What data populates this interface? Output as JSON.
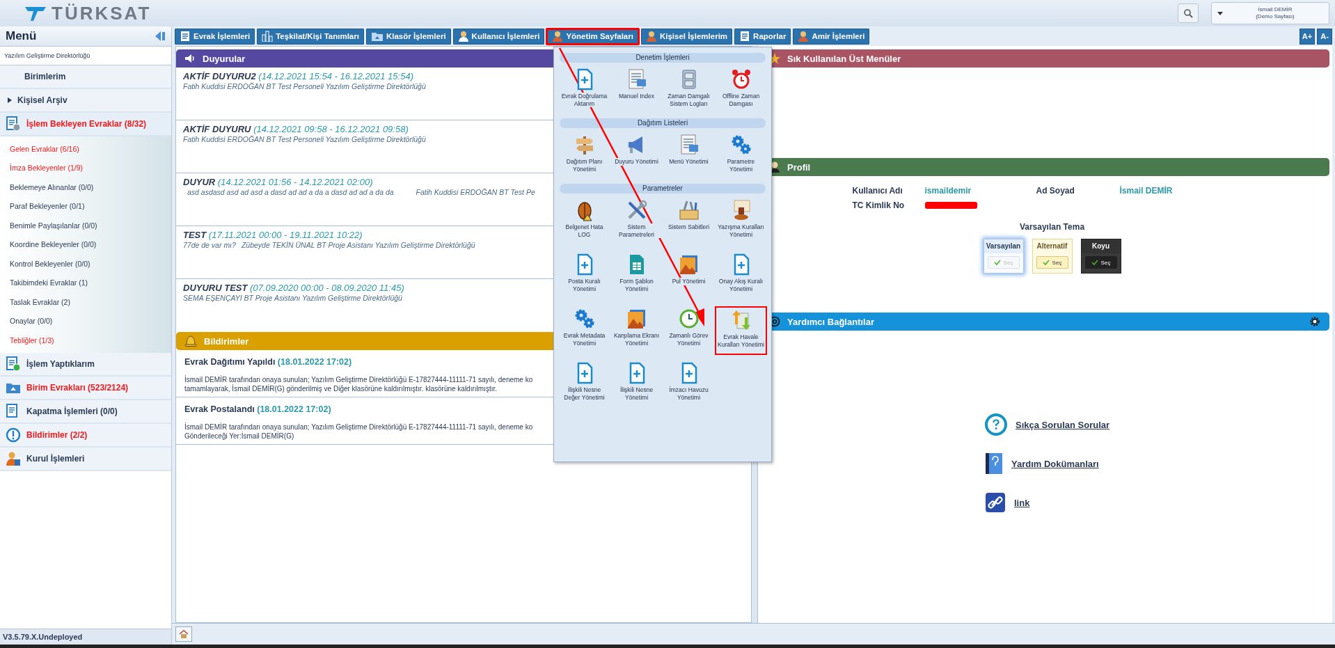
{
  "header": {
    "logo": "TÜRKSAT",
    "user": {
      "name": "İsmail DEMİR",
      "subtitle": "(Demo Sayfası)"
    }
  },
  "sidebar": {
    "title": "Menü",
    "unit": "Yazılım Geliştirme Direktörlüğü",
    "version": "V3.5.79.X.Undeployed",
    "items": [
      {
        "label": "Birimlerim",
        "alert": false
      },
      {
        "label": "Kişisel Arşiv",
        "alert": false
      },
      {
        "label": "İşlem Bekleyen Evraklar (8/32)",
        "alert": true,
        "expanded": true,
        "children": [
          {
            "label": "Gelen Evraklar (6/16)",
            "alert": true
          },
          {
            "label": "İmza Bekleyenler (1/9)",
            "alert": true
          },
          {
            "label": "Beklemeye Alınanlar (0/0)",
            "alert": false
          },
          {
            "label": "Paraf Bekleyenler (0/1)",
            "alert": false
          },
          {
            "label": "Benimle Paylaşılanlar (0/0)",
            "alert": false
          },
          {
            "label": "Koordine Bekleyenler (0/0)",
            "alert": false
          },
          {
            "label": "Kontrol Bekleyenler (0/0)",
            "alert": false
          },
          {
            "label": "Takibimdeki Evraklar (1)",
            "alert": false
          },
          {
            "label": "Taslak Evraklar (2)",
            "alert": false
          },
          {
            "label": "Onaylar (0/0)",
            "alert": false
          },
          {
            "label": "Tebliğler (1/3)",
            "alert": true
          }
        ]
      },
      {
        "label": "İşlem Yaptıklarım",
        "alert": false
      },
      {
        "label": "Birim Evrakları (523/2124)",
        "alert": true
      },
      {
        "label": "Kapatma İşlemleri (0/0)",
        "alert": false
      },
      {
        "label": "Bildirimler (2/2)",
        "alert": true
      },
      {
        "label": "Kurul İşlemleri",
        "alert": false
      }
    ]
  },
  "toolbar": {
    "buttons": [
      {
        "label": "Evrak İşlemleri",
        "highlighted": false
      },
      {
        "label": "Teşkilat/Kişi Tanımları",
        "highlighted": false
      },
      {
        "label": "Klasör İşlemleri",
        "highlighted": false
      },
      {
        "label": "Kullanıcı İşlemleri",
        "highlighted": false
      },
      {
        "label": "Yönetim Sayfaları",
        "highlighted": true
      },
      {
        "label": "Kişisel İşlemlerim",
        "highlighted": false
      },
      {
        "label": "Raporlar",
        "highlighted": false
      },
      {
        "label": "Amir İşlemleri",
        "highlighted": false
      }
    ],
    "font_buttons": [
      "A+",
      "A-"
    ]
  },
  "dropdown": {
    "sections": [
      {
        "title": "Denetim İşlemleri",
        "items": [
          {
            "label": "Evrak Doğrulama Aktarım",
            "highlighted": false
          },
          {
            "label": "Manuel Index",
            "highlighted": false
          },
          {
            "label": "Zaman Damgalı Sistem Logları",
            "highlighted": false
          },
          {
            "label": "Offline Zaman Damgası",
            "highlighted": false
          }
        ]
      },
      {
        "title": "Dağıtım Listeleri",
        "items": [
          {
            "label": "Dağıtım Planı Yönetimi",
            "highlighted": false
          },
          {
            "label": "Duyuru Yönetimi",
            "highlighted": false
          },
          {
            "label": "Menü Yönetimi",
            "highlighted": false
          },
          {
            "label": "Parametre Yönetimi",
            "highlighted": false
          }
        ]
      },
      {
        "title": "Parametreler",
        "items": [
          {
            "label": "Belgenet Hata LOG",
            "highlighted": false
          },
          {
            "label": "Sistem Parametreleri",
            "highlighted": false
          },
          {
            "label": "Sistem Sabitleri",
            "highlighted": false
          },
          {
            "label": "Yazışma Kuralları Yönetimi",
            "highlighted": false
          },
          {
            "label": "Posta Kuralı Yönetimi",
            "highlighted": false
          },
          {
            "label": "Form Şablon Yönetimi",
            "highlighted": false
          },
          {
            "label": "Pul Yönetimi",
            "highlighted": false
          },
          {
            "label": "Onay Akış Kuralı Yönetimi",
            "highlighted": false
          },
          {
            "label": "Evrak Metadata Yönetimi",
            "highlighted": false
          },
          {
            "label": "Karşılama Ekranı Yönetimi",
            "highlighted": false
          },
          {
            "label": "Zamanlı Görev Yönetimi",
            "highlighted": false
          },
          {
            "label": "Evrak Havale Kuralları Yönetimi",
            "highlighted": true
          },
          {
            "label": "İlişkili Nesne Değer Yönetimi",
            "highlighted": false
          },
          {
            "label": "İlişkili Nesne Yönetimi",
            "highlighted": false
          },
          {
            "label": "İmzacı Havuzu Yönetimi",
            "highlighted": false
          }
        ]
      }
    ]
  },
  "annotation_arrow": true,
  "announcements": {
    "title": "Duyurular",
    "items": [
      {
        "title": "AKTİF DUYURU2",
        "period": "(14.12.2021 15:54 - 16.12.2021 15:54)",
        "author": "Fatih Kuddisi ERDOĞAN BT Test Personeli Yazılım Geliştirme Direktörlüğü"
      },
      {
        "title": "AKTİF DUYURU",
        "period": "(14.12.2021 09:58 - 16.12.2021 09:58)",
        "author": "Fatih Kuddisi ERDOĞAN BT Test Personeli Yazılım Geliştirme Direktörlüğü"
      },
      {
        "title": "DUYUR",
        "period": "(14.12.2021 01:56 - 14.12.2021 02:00)",
        "message": "asd asdasd asd ad asd a dasd ad ad a da a dasd ad ad a da da",
        "author": "Fatih Kuddisi ERDOĞAN BT Test Pe"
      },
      {
        "title": "TEST",
        "period": "(17.11.2021 00:00 - 19.11.2021 10:22)",
        "message": "77de de var mı?",
        "author": "Zübeyde TEKİN ÜNAL BT Proje Asistanı Yazılım Geliştirme Direktörlüğü"
      },
      {
        "title": "DUYURU TEST",
        "period": "(07.09.2020 00:00 - 08.09.2020 11:45)",
        "author": "SEMA EŞENÇAYI BT Proje Asistanı Yazılım Geliştirme Direktörlüğü"
      }
    ]
  },
  "notifications": {
    "title": "Bildirimler",
    "items": [
      {
        "title": "Evrak Dağıtımı Yapıldı",
        "time": "(18.01.2022 17:02)",
        "lines": [
          "İsmail DEMİR tarafından onaya sunulan; Yazılım Geliştirme Direktörlüğü E-17827444-11111-71 sayılı, deneme ko",
          "tamamlayarak, İsmail DEMİR(G) gönderilmiş ve Diğer klasörüne kaldırılmıştır. klasörüne kaldırılmıştır."
        ]
      },
      {
        "title": "Evrak Postalandı",
        "time": "(18.01.2022 17:02)",
        "lines": [
          "İsmail DEMİR tarafından onaya sunulan; Yazılım Geliştirme Direktörlüğü E-17827444-11111-71 sayılı, deneme ko",
          "Gönderileceği Yer:İsmail DEMİR(G)"
        ]
      }
    ]
  },
  "favorites": {
    "title": "Sık Kullanılan Üst Menüler"
  },
  "profile": {
    "title": "Profil",
    "fields": [
      {
        "label": "Kullanıcı Adı",
        "value": "ismaildemir"
      },
      {
        "label": "Ad Soyad",
        "value": "İsmail DEMİR"
      },
      {
        "label": "TC Kimlik No",
        "redacted": true
      }
    ],
    "theme_title": "Varsayılan Tema",
    "themes": [
      {
        "name": "Varsayılan",
        "button": "Seç",
        "kind": "default",
        "selected": true
      },
      {
        "name": "Alternatif",
        "button": "Seç",
        "kind": "alternative",
        "selected": false
      },
      {
        "name": "Koyu",
        "button": "Seç",
        "kind": "dark",
        "selected": false
      }
    ]
  },
  "links": {
    "title": "Yardımcı Bağlantılar",
    "items": [
      "Sıkça Sorulan Sorular",
      "Yardım Dokümanları",
      "link"
    ]
  }
}
